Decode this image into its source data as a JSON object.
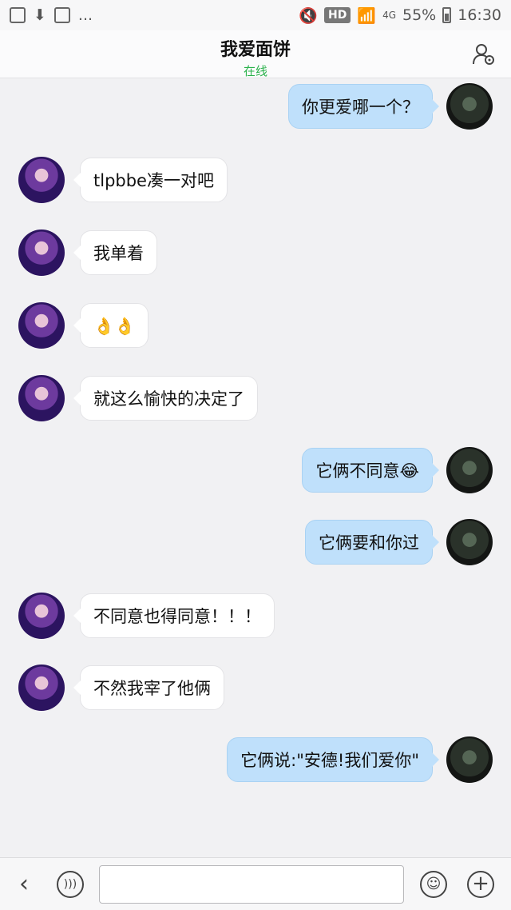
{
  "statusbar": {
    "more": "...",
    "hd": "HD",
    "network": "4G",
    "battery": "55%",
    "time": "16:30"
  },
  "header": {
    "title": "我爱面饼",
    "status": "在线"
  },
  "messages": [
    {
      "side": "out",
      "text": "你更爱哪一个？"
    },
    {
      "side": "in",
      "text": "tlpbbe凑一对吧"
    },
    {
      "side": "in",
      "text": "我单着"
    },
    {
      "side": "in",
      "text": "👌👌"
    },
    {
      "side": "in",
      "text": "就这么愉快的决定了"
    },
    {
      "side": "out",
      "text": "它俩不同意😂"
    },
    {
      "side": "out",
      "text": "它俩要和你过"
    },
    {
      "side": "in",
      "text": "不同意也得同意！！！"
    },
    {
      "side": "in",
      "text": "不然我宰了他俩"
    },
    {
      "side": "out",
      "text": "它俩说:\"安德!我们爱你\""
    }
  ],
  "bottombar": {
    "input_value": "",
    "icons": [
      "back-icon",
      "voice-icon",
      "emoji-icon",
      "plus-icon"
    ]
  },
  "colors": {
    "incoming_bubble": "#ffffff",
    "outgoing_bubble": "#bfe0fb",
    "online_status": "#2bb24c",
    "background": "#f1f1f3"
  }
}
